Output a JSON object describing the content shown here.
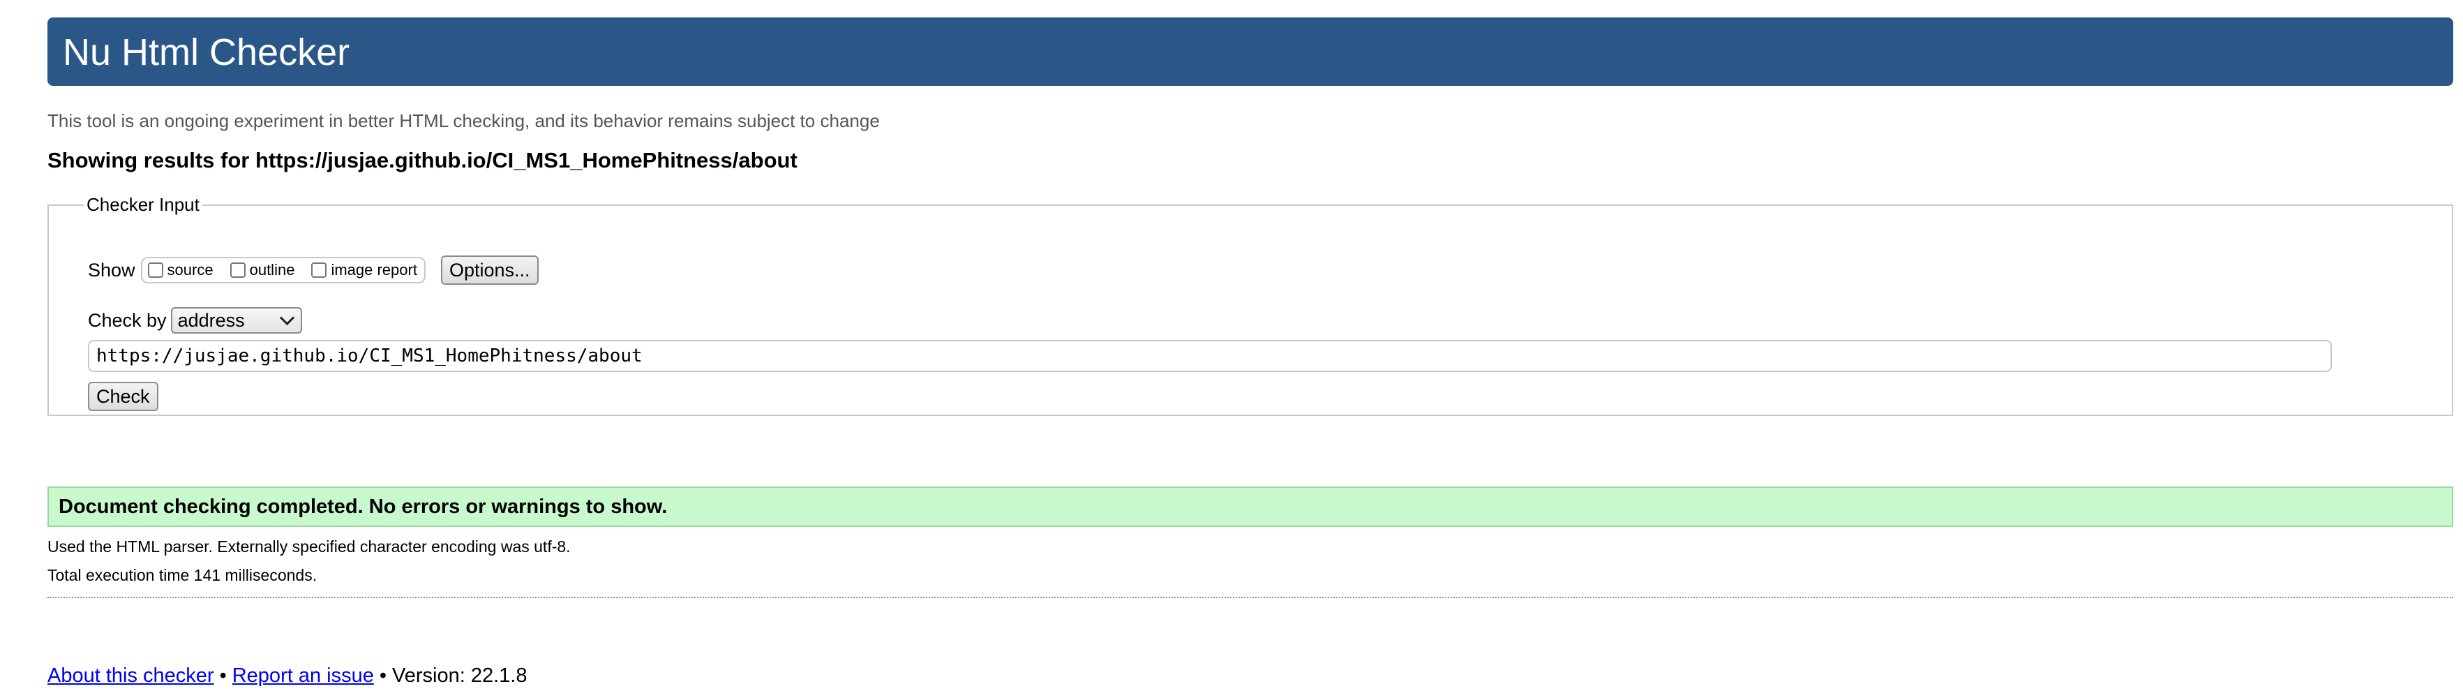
{
  "header": {
    "title": "Nu Html Checker"
  },
  "tagline": "This tool is an ongoing experiment in better HTML checking, and its behavior remains subject to change",
  "results_for": "Showing results for https://jusjae.github.io/CI_MS1_HomePhitness/about",
  "checker_input": {
    "legend": "Checker Input",
    "show_label": "Show",
    "show_options": [
      {
        "label": "source",
        "checked": false
      },
      {
        "label": "outline",
        "checked": false
      },
      {
        "label": "image report",
        "checked": false
      }
    ],
    "options_button": "Options...",
    "check_by_label": "Check by",
    "check_by_value": "address",
    "url_value": "https://jusjae.github.io/CI_MS1_HomePhitness/about",
    "check_button": "Check"
  },
  "result": {
    "status": "Document checking completed. No errors or warnings to show.",
    "status_color": "#c7f9cc",
    "parser_line": "Used the HTML parser. Externally specified character encoding was utf-8.",
    "timing_line": "Total execution time 141 milliseconds."
  },
  "footer": {
    "about_link": "About this checker",
    "separator": "•",
    "report_link": "Report an issue",
    "version": "Version: 22.1.8"
  },
  "colors": {
    "header_bg": "#2b5788",
    "link": "#0000ee"
  }
}
